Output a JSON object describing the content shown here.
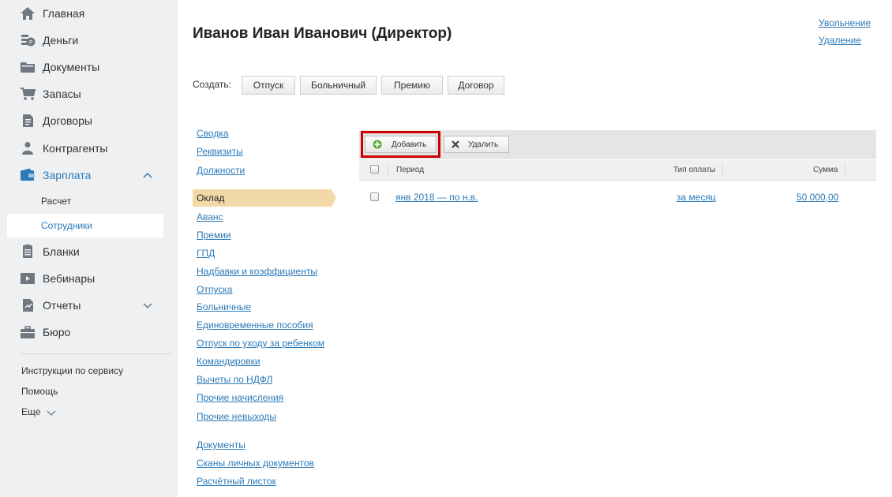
{
  "sidebar": {
    "items": [
      {
        "label": "Главная",
        "icon": "home-icon"
      },
      {
        "label": "Деньги",
        "icon": "money-icon"
      },
      {
        "label": "Документы",
        "icon": "folder-icon"
      },
      {
        "label": "Запасы",
        "icon": "cart-icon"
      },
      {
        "label": "Договоры",
        "icon": "contract-icon"
      },
      {
        "label": "Контрагенты",
        "icon": "people-icon"
      },
      {
        "label": "Зарплата",
        "icon": "wallet-icon"
      },
      {
        "label": "Бланки",
        "icon": "form-icon"
      },
      {
        "label": "Вебинары",
        "icon": "video-icon"
      },
      {
        "label": "Отчеты",
        "icon": "report-icon"
      },
      {
        "label": "Бюро",
        "icon": "briefcase-icon"
      }
    ],
    "submenu": [
      {
        "label": "Расчет"
      },
      {
        "label": "Сотрудники"
      }
    ],
    "bottom_links": [
      {
        "label": "Инструкции по сервису"
      },
      {
        "label": "Помощь"
      },
      {
        "label": "Еще"
      }
    ]
  },
  "header": {
    "title": "Иванов Иван Иванович (Директор)",
    "links": [
      {
        "label": "Увольнение"
      },
      {
        "label": "Удаление"
      }
    ]
  },
  "create": {
    "label": "Создать:",
    "buttons": [
      {
        "label": "Отпуск"
      },
      {
        "label": "Больничный"
      },
      {
        "label": "Премию"
      },
      {
        "label": "Договор"
      }
    ]
  },
  "menu": {
    "top": [
      {
        "label": "Сводка"
      },
      {
        "label": "Реквизиты"
      },
      {
        "label": "Должности"
      }
    ],
    "active": "Оклад",
    "middle": [
      {
        "label": "Аванс"
      },
      {
        "label": "Премии"
      },
      {
        "label": "ГПД"
      },
      {
        "label": "Надбавки и коэффициенты"
      },
      {
        "label": "Отпуска"
      },
      {
        "label": "Больничные"
      },
      {
        "label": "Единовременные пособия"
      },
      {
        "label": "Отпуск по уходу за ребенком"
      },
      {
        "label": "Командировки"
      },
      {
        "label": "Вычеты по НДФЛ"
      },
      {
        "label": "Прочие начисления"
      },
      {
        "label": "Прочие невыходы"
      }
    ],
    "bottom": [
      {
        "label": "Документы"
      },
      {
        "label": "Сканы личных документов"
      },
      {
        "label": "Расчётный листок"
      }
    ]
  },
  "table": {
    "toolbar": {
      "add_label": "Добавить",
      "delete_label": "Удалить"
    },
    "columns": [
      "Период",
      "Тип оплаты",
      "Сумма"
    ],
    "rows": [
      {
        "period": "янв 2018 — по н.в.",
        "pay_type": "за месяц",
        "amount": "50 000,00"
      }
    ]
  },
  "colors": {
    "accent": "#2c7ab8",
    "active_menu": "#f3d9a8",
    "highlight_border": "#cc0000",
    "add_icon": "#5aa936"
  }
}
